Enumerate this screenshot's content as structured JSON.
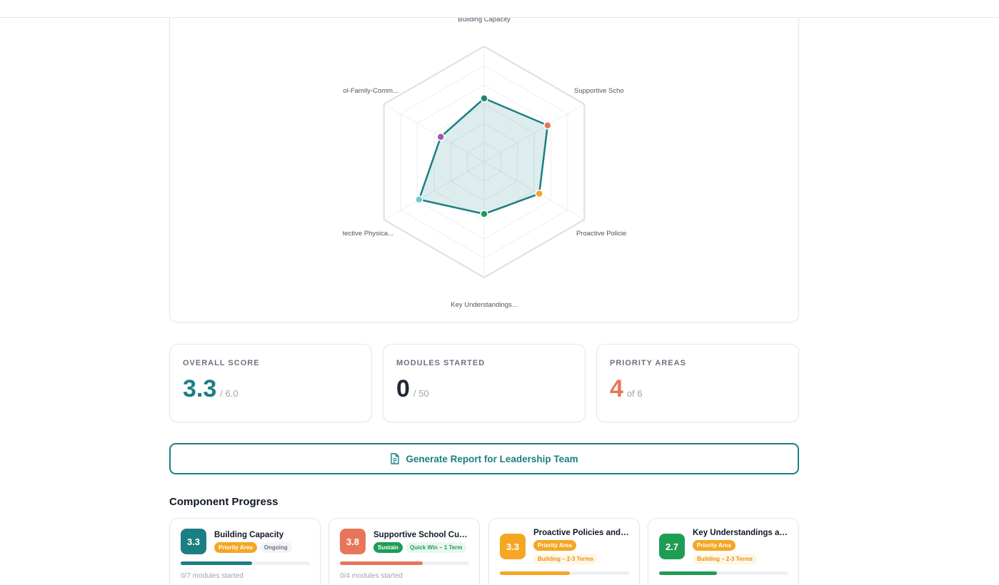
{
  "radar": {
    "axes": [
      "Building Capacity",
      "Supportive Scho",
      "Proactive Policie",
      "Key Understandings...",
      "tective Physica...",
      "ol-Family-Comm..."
    ],
    "scores": [
      3.3,
      3.8,
      3.3,
      2.7,
      3.9,
      2.6
    ],
    "max": 6,
    "point_colors": [
      "#1a8a6e",
      "#e8755a",
      "#f5a623",
      "#1f9d55",
      "#6fc9cf",
      "#9b59b6"
    ],
    "line_color": "#1b7f83"
  },
  "stats": [
    {
      "label": "OVERALL SCORE",
      "value": "3.3",
      "suffix": "/ 6.0",
      "color": "#1b7f83"
    },
    {
      "label": "MODULES STARTED",
      "value": "0",
      "suffix": "/ 50",
      "color": "#1f2937"
    },
    {
      "label": "PRIORITY AREAS",
      "value": "4",
      "suffix": "of 6",
      "color": "#e8755a"
    }
  ],
  "report_button": {
    "label": "Generate Report for Leadership Team"
  },
  "component_section": {
    "title": "Component Progress"
  },
  "components": [
    {
      "score": "3.3",
      "title": "Building Capacity",
      "color": "#1b7f83",
      "badges": [
        {
          "text": "Priority Area",
          "kind": "priority"
        },
        {
          "text": "Ongoing",
          "kind": "ongoing"
        }
      ],
      "progress": 0.55,
      "modules": "0/7 modules started"
    },
    {
      "score": "3.8",
      "title": "Supportive School Cult...",
      "color": "#e8755a",
      "badges": [
        {
          "text": "Sustain",
          "kind": "sustain"
        },
        {
          "text": "Quick Win – 1 Term",
          "kind": "quickwin"
        }
      ],
      "progress": 0.64,
      "modules": "0/4 modules started"
    },
    {
      "score": "3.3",
      "title": "Proactive Policies and ...",
      "color": "#f5a623",
      "badges": [
        {
          "text": "Priority Area",
          "kind": "priority"
        },
        {
          "text": "Building – 2-3 Terms",
          "kind": "building"
        }
      ],
      "progress": 0.54,
      "modules": ""
    },
    {
      "score": "2.7",
      "title": "Key Understandings an...",
      "color": "#1f9d55",
      "badges": [
        {
          "text": "Priority Area",
          "kind": "priority"
        },
        {
          "text": "Building – 2-3 Terms",
          "kind": "building"
        }
      ],
      "progress": 0.45,
      "modules": ""
    }
  ]
}
